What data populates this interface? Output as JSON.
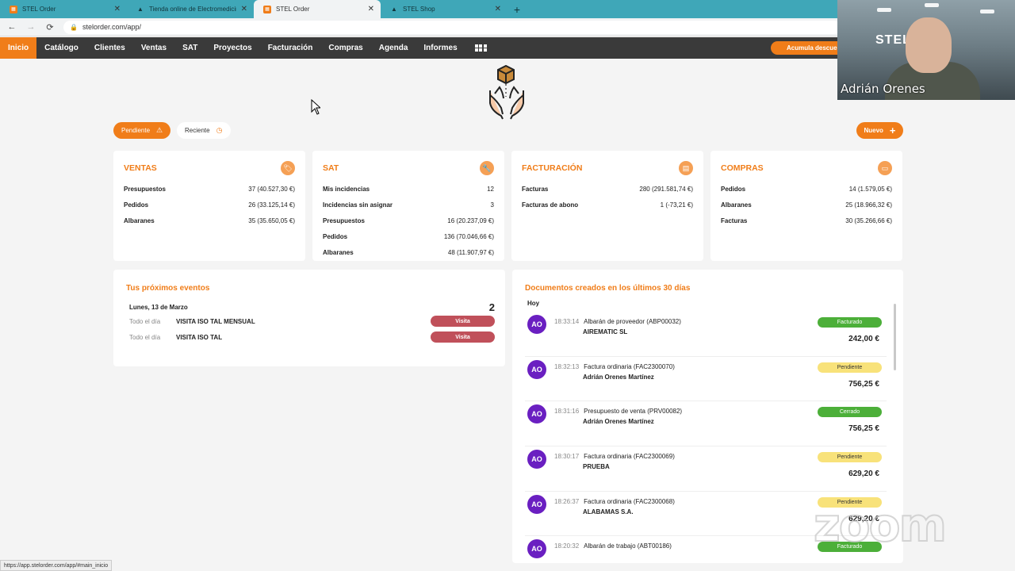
{
  "browser": {
    "tabs": [
      {
        "title": "STEL Order",
        "fav": "orange"
      },
      {
        "title": "Tienda online de Electromedicina",
        "fav": "dark"
      },
      {
        "title": "STEL Order",
        "fav": "orange"
      },
      {
        "title": "STEL Shop",
        "fav": "dark"
      }
    ],
    "active_tab": 2,
    "url": "stelorder.com/app/",
    "status_url": "https://app.stelorder.com/app/#main_inicio"
  },
  "nav": {
    "items": [
      "Inicio",
      "Catálogo",
      "Clientes",
      "Ventas",
      "SAT",
      "Proyectos",
      "Facturación",
      "Compras",
      "Agenda",
      "Informes"
    ],
    "active": 0,
    "promo": "Acumula descue"
  },
  "filters": {
    "pending": "Pendiente",
    "recent": "Reciente",
    "new_button": "Nuevo"
  },
  "cards": [
    {
      "title": "VENTAS",
      "icon": "tag-icon",
      "glyph": "🏷",
      "rows": [
        {
          "label": "Presupuestos",
          "value": "37 (40.527,30 €)"
        },
        {
          "label": "Pedidos",
          "value": "26 (33.125,14 €)"
        },
        {
          "label": "Albaranes",
          "value": "35 (35.650,05 €)"
        }
      ]
    },
    {
      "title": "SAT",
      "icon": "wrench-icon",
      "glyph": "🔧",
      "rows": [
        {
          "label": "Mis incidencias",
          "value": "12"
        },
        {
          "label": "Incidencias sin asignar",
          "value": "3"
        },
        {
          "label": "Presupuestos",
          "value": "16 (20.237,09 €)"
        },
        {
          "label": "Pedidos",
          "value": "136 (70.046,66 €)"
        },
        {
          "label": "Albaranes",
          "value": "48 (11.907,97 €)"
        }
      ]
    },
    {
      "title": "FACTURACIÓN",
      "icon": "document-icon",
      "glyph": "▤",
      "rows": [
        {
          "label": "Facturas",
          "value": "280 (291.581,74 €)"
        },
        {
          "label": "Facturas de abono",
          "value": "1 (-73,21 €)"
        }
      ]
    },
    {
      "title": "COMPRAS",
      "icon": "shopping-icon",
      "glyph": "▭",
      "rows": [
        {
          "label": "Pedidos",
          "value": "14 (1.579,05 €)"
        },
        {
          "label": "Albaranes",
          "value": "25 (18.966,32 €)"
        },
        {
          "label": "Facturas",
          "value": "30 (35.266,66 €)"
        }
      ]
    }
  ],
  "events": {
    "title": "Tus próximos eventos",
    "date": "Lunes, 13 de Marzo",
    "count": "2",
    "items": [
      {
        "when": "Todo el día",
        "what": "VISITA ISO TAL MENSUAL",
        "badge": "Visita"
      },
      {
        "when": "Todo el día",
        "what": "VISITA ISO TAL",
        "badge": "Visita"
      }
    ]
  },
  "documents": {
    "title": "Documentos creados en los últimos 30 días",
    "group": "Hoy",
    "items": [
      {
        "avatar": "AO",
        "time": "18:33:14",
        "doc": "Albarán de proveedor (ABP00032)",
        "client": "AIREMATIC SL",
        "status": "Facturado",
        "status_color": "green",
        "amount": "242,00 €"
      },
      {
        "avatar": "AO",
        "time": "18:32:13",
        "doc": "Factura ordinaria (FAC2300070)",
        "client": "Adrián Orenes Martínez",
        "status": "Pendiente",
        "status_color": "yellow",
        "amount": "756,25 €"
      },
      {
        "avatar": "AO",
        "time": "18:31:16",
        "doc": "Presupuesto de venta (PRV00082)",
        "client": "Adrián Orenes Martínez",
        "status": "Cerrado",
        "status_color": "green",
        "amount": "756,25 €"
      },
      {
        "avatar": "AO",
        "time": "18:30:17",
        "doc": "Factura ordinaria (FAC2300069)",
        "client": "PRUEBA",
        "status": "Pendiente",
        "status_color": "yellow",
        "amount": "629,20 €"
      },
      {
        "avatar": "AO",
        "time": "18:26:37",
        "doc": "Factura ordinaria (FAC2300068)",
        "client": "ALABAMAS S.A.",
        "status": "Pendiente",
        "status_color": "yellow",
        "amount": "629,20 €"
      },
      {
        "avatar": "AO",
        "time": "18:20:32",
        "doc": "Albarán de trabajo (ABT00186)",
        "client": "",
        "status": "Facturado",
        "status_color": "green",
        "amount": ""
      }
    ]
  },
  "webcam": {
    "name": "Adrián Orenes",
    "logo": "STEL",
    "watermark": "zoom"
  },
  "colors": {
    "accent": "#f07d19",
    "nav_bg": "#3a3a3a",
    "tabbar": "#3fa7b8",
    "avatar": "#6a1fc1"
  }
}
